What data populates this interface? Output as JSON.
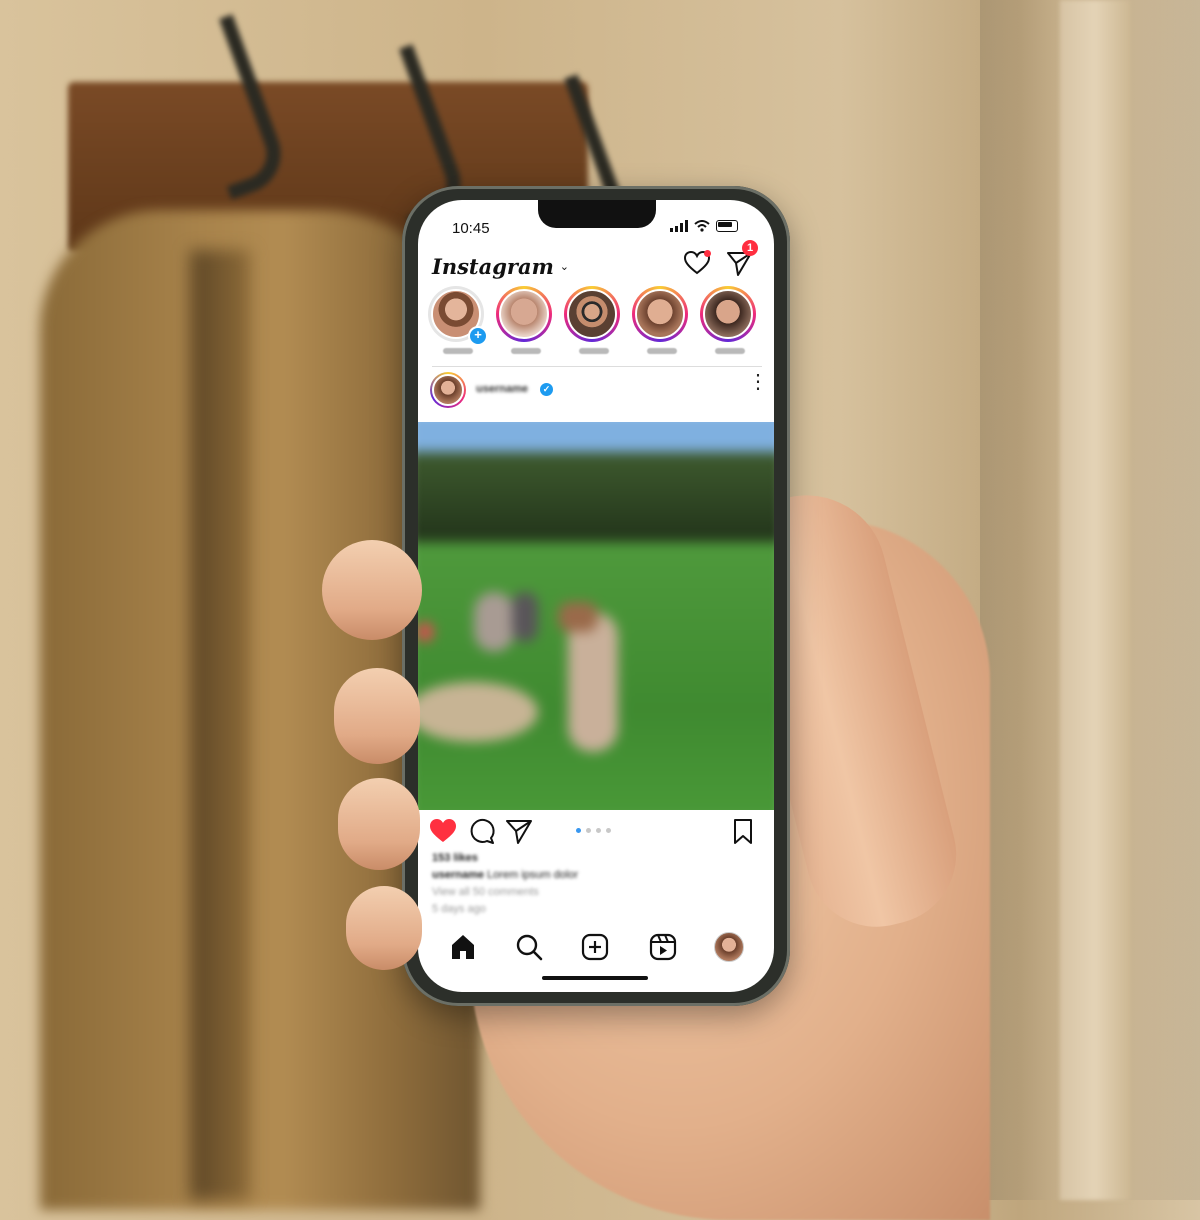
{
  "status_bar": {
    "time": "10:45"
  },
  "header": {
    "logo": "Instagram",
    "dm_badge_count": "1",
    "icons": [
      "heart-icon",
      "direct-message-icon"
    ]
  },
  "stories": [
    {
      "name": "",
      "own": true
    },
    {
      "name": ""
    },
    {
      "name": ""
    },
    {
      "name": ""
    },
    {
      "name": ""
    }
  ],
  "post": {
    "username": "username",
    "verified": true,
    "liked": true,
    "carousel": {
      "count": 4,
      "active": 1
    },
    "likes": "153 likes",
    "caption_user": "username",
    "caption_text": "Lorem ipsum dolor",
    "view_comments": "View all 50 comments",
    "time_ago": "5 days ago"
  },
  "tabbar": {
    "items": [
      "home-icon",
      "search-icon",
      "create-icon",
      "reels-icon",
      "profile-avatar"
    ]
  },
  "colors": {
    "like": "#ff3040",
    "badge": "#ff2e40",
    "verified": "#1d9bf0",
    "carousel_active": "#3897f0"
  }
}
